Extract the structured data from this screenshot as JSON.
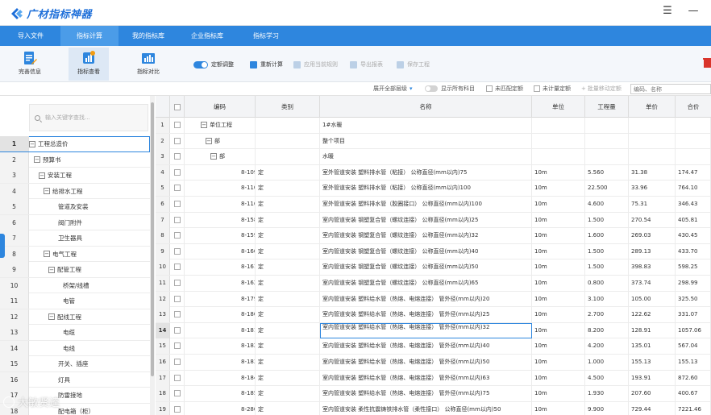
{
  "app": {
    "title": "广材指标神器"
  },
  "nav": {
    "tabs": [
      {
        "label": "导入文件"
      },
      {
        "label": "指标计算"
      },
      {
        "label": "我的指标库"
      },
      {
        "label": "企业指标库"
      },
      {
        "label": "指标学习"
      }
    ]
  },
  "ribbon": {
    "big": [
      {
        "label": "完善信息"
      },
      {
        "label": "指标查看"
      },
      {
        "label": "指标对比"
      }
    ],
    "small": [
      {
        "label": "定额调整"
      },
      {
        "label": "重新计算"
      },
      {
        "label": "应用当前规则"
      },
      {
        "label": "导出报表"
      },
      {
        "label": "保存工程"
      }
    ]
  },
  "options": {
    "expand_label": "展开全部层级",
    "show_all_label": "显示所有科目",
    "unmatched_label": "未匹配定额",
    "uncounted_label": "未计量定额",
    "batch_label": "批量移动定额",
    "search_placeholder": "编码、名称"
  },
  "tree": {
    "search_placeholder": "输入关键字查找...",
    "rows": [
      {
        "num": "1",
        "label": "工程总造价",
        "box": "−"
      },
      {
        "num": "2",
        "label": "预算书",
        "box": "−"
      },
      {
        "num": "3",
        "label": "安装工程",
        "box": "−"
      },
      {
        "num": "4",
        "label": "给排水工程",
        "box": "−"
      },
      {
        "num": "5",
        "label": "管道及安装",
        "box": ""
      },
      {
        "num": "6",
        "label": "阀门附件",
        "box": ""
      },
      {
        "num": "7",
        "label": "卫生器具",
        "box": ""
      },
      {
        "num": "8",
        "label": "电气工程",
        "box": "−"
      },
      {
        "num": "9",
        "label": "配管工程",
        "box": "−"
      },
      {
        "num": "10",
        "label": "桥架/线槽",
        "box": ""
      },
      {
        "num": "11",
        "label": "电管",
        "box": ""
      },
      {
        "num": "12",
        "label": "配线工程",
        "box": "−"
      },
      {
        "num": "13",
        "label": "电缆",
        "box": ""
      },
      {
        "num": "14",
        "label": "电线",
        "box": ""
      },
      {
        "num": "15",
        "label": "开关、插座",
        "box": ""
      },
      {
        "num": "16",
        "label": "灯具",
        "box": ""
      },
      {
        "num": "17",
        "label": "防雷接地",
        "box": ""
      },
      {
        "num": "18",
        "label": "配电箱（柜）",
        "box": ""
      }
    ]
  },
  "grid": {
    "headers": {
      "code": "编码",
      "type": "类别",
      "name": "名称",
      "unit": "单位",
      "qty": "工程量",
      "price": "单价",
      "total": "合价"
    },
    "rows": [
      {
        "num": "1",
        "code": "单位工程",
        "type": "",
        "name": "1#水暖",
        "unit": "",
        "qty": "",
        "price": "",
        "total": ""
      },
      {
        "num": "2",
        "code": "部",
        "type": "",
        "name": "整个项目",
        "unit": "",
        "qty": "",
        "price": "",
        "total": ""
      },
      {
        "num": "3",
        "code": "部",
        "type": "",
        "name": "水暖",
        "unit": "",
        "qty": "",
        "price": "",
        "total": ""
      },
      {
        "num": "4",
        "code": "8-109",
        "type": "定",
        "name": "室外管道安装 塑料排水管（粘接） 公称直径(mm以内)75",
        "unit": "10m",
        "qty": "5.560",
        "price": "31.38",
        "total": "174.47"
      },
      {
        "num": "5",
        "code": "8-110",
        "type": "定",
        "name": "室外管道安装 塑料排水管（粘接） 公称直径(mm以内)100",
        "unit": "10m",
        "qty": "22.500",
        "price": "33.96",
        "total": "764.10"
      },
      {
        "num": "6",
        "code": "8-116",
        "type": "定",
        "name": "室外管道安装 塑料排水管（胶圈接口） 公称直径(mm以内)100",
        "unit": "10m",
        "qty": "4.600",
        "price": "75.31",
        "total": "346.43"
      },
      {
        "num": "7",
        "code": "8-158",
        "type": "定",
        "name": "室内管道安装 钢塑复合管（螺纹连接） 公称直径(mm以内)25",
        "unit": "10m",
        "qty": "1.500",
        "price": "270.54",
        "total": "405.81"
      },
      {
        "num": "8",
        "code": "8-159",
        "type": "定",
        "name": "室内管道安装 钢塑复合管（螺纹连接） 公称直径(mm以内)32",
        "unit": "10m",
        "qty": "1.600",
        "price": "269.03",
        "total": "430.45"
      },
      {
        "num": "9",
        "code": "8-160",
        "type": "定",
        "name": "室内管道安装 钢塑复合管（螺纹连接） 公称直径(mm以内)40",
        "unit": "10m",
        "qty": "1.500",
        "price": "289.13",
        "total": "433.70"
      },
      {
        "num": "10",
        "code": "8-161",
        "type": "定",
        "name": "室内管道安装 钢塑复合管（螺纹连接） 公称直径(mm以内)50",
        "unit": "10m",
        "qty": "1.500",
        "price": "398.83",
        "total": "598.25"
      },
      {
        "num": "11",
        "code": "8-162",
        "type": "定",
        "name": "室内管道安装 钢塑复合管（螺纹连接） 公称直径(mm以内)65",
        "unit": "10m",
        "qty": "0.800",
        "price": "373.74",
        "total": "298.99"
      },
      {
        "num": "12",
        "code": "8-179",
        "type": "定",
        "name": "室内管道安装 塑料给水管（热熔、电熔连接） 管外径(mm以内)20",
        "unit": "10m",
        "qty": "3.100",
        "price": "105.00",
        "total": "325.50"
      },
      {
        "num": "13",
        "code": "8-180",
        "type": "定",
        "name": "室内管道安装 塑料给水管（热熔、电熔连接） 管外径(mm以内)25",
        "unit": "10m",
        "qty": "2.700",
        "price": "122.62",
        "total": "331.07"
      },
      {
        "num": "14",
        "code": "8-181",
        "type": "定",
        "name": "室内管道安装 塑料给水管（热熔、电熔连接） 管外径(mm以内)32",
        "unit": "10m",
        "qty": "8.200",
        "price": "128.91",
        "total": "1057.06"
      },
      {
        "num": "15",
        "code": "8-182",
        "type": "定",
        "name": "室内管道安装 塑料给水管（热熔、电熔连接） 管外径(mm以内)40",
        "unit": "10m",
        "qty": "4.200",
        "price": "135.01",
        "total": "567.04"
      },
      {
        "num": "16",
        "code": "8-183",
        "type": "定",
        "name": "室内管道安装 塑料给水管（热熔、电熔连接） 管外径(mm以内)50",
        "unit": "10m",
        "qty": "1.000",
        "price": "155.13",
        "total": "155.13"
      },
      {
        "num": "17",
        "code": "8-184",
        "type": "定",
        "name": "室内管道安装 塑料给水管（热熔、电熔连接） 管外径(mm以内)63",
        "unit": "10m",
        "qty": "4.500",
        "price": "193.91",
        "total": "872.60"
      },
      {
        "num": "18",
        "code": "8-185",
        "type": "定",
        "name": "室内管道安装 塑料给水管（热熔、电熔连接） 管外径(mm以内)75",
        "unit": "10m",
        "qty": "1.930",
        "price": "207.60",
        "total": "400.67"
      },
      {
        "num": "19",
        "code": "8-280",
        "type": "定",
        "name": "室内管道安装 柔性抗震铸铁排水管（柔性接口） 公称直径(mm以内)50",
        "unit": "10m",
        "qty": "9.900",
        "price": "729.44",
        "total": "7221.46"
      }
    ]
  },
  "watermark": {
    "text": "大敏贤逵"
  },
  "colors": {
    "brand": "#2e86de",
    "logo": "#1e6fd9"
  }
}
